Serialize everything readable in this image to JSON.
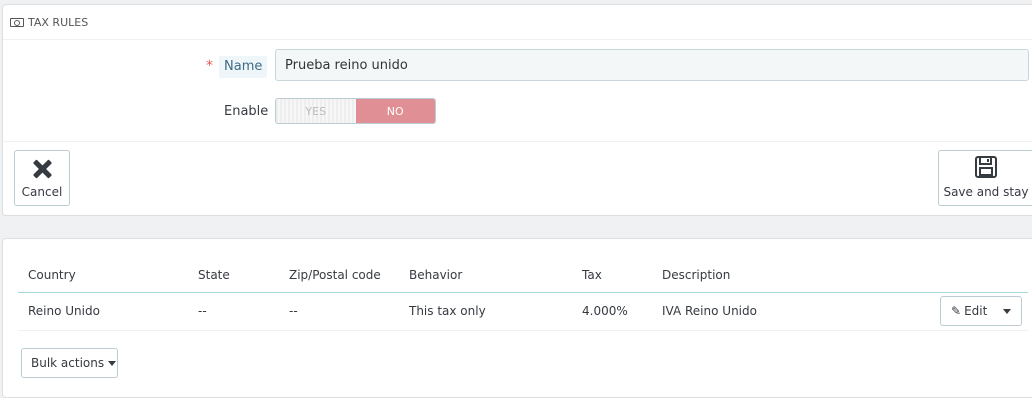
{
  "panel_rules": {
    "heading_icon": "money-icon",
    "heading": "TAX RULES",
    "name_required_marker": "*",
    "name_label": "Name",
    "name_value": "Prueba reino unido",
    "enable_label": "Enable",
    "enable_options": {
      "yes": "YES",
      "no": "NO",
      "selected": "NO"
    },
    "cancel_label": "Cancel",
    "cancel_icon": "close-icon",
    "save_label": "Save and stay",
    "save_icon": "save-icon"
  },
  "table": {
    "columns": [
      "Country",
      "State",
      "Zip/Postal code",
      "Behavior",
      "Tax",
      "Description"
    ],
    "rows": [
      {
        "country": "Reino Unido",
        "state": "--",
        "zip": "--",
        "behavior": "This tax only",
        "tax": "4.000%",
        "description": "IVA Reino Unido"
      }
    ],
    "row_action_label": "Edit",
    "row_action_icon": "pencil-icon",
    "bulk_label": "Bulk actions"
  },
  "colors": {
    "accent": "#25b9d7",
    "switch_no": "#e08f95",
    "required": "#e35d5d"
  }
}
